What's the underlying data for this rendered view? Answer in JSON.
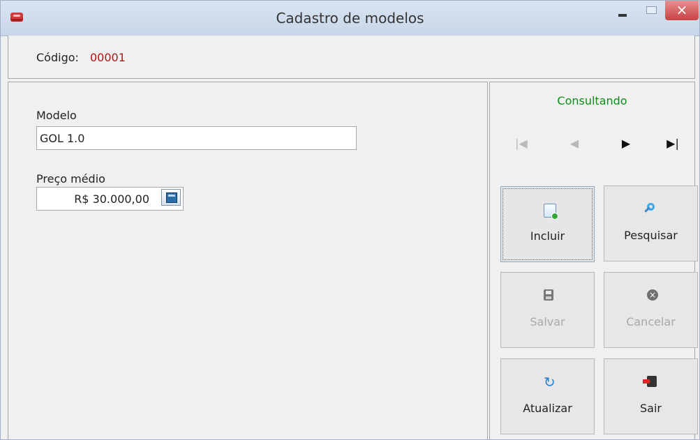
{
  "window": {
    "title": "Cadastro de modelos",
    "close": "×"
  },
  "code": {
    "label": "Código:",
    "value": "00001"
  },
  "form": {
    "model_label": "Modelo",
    "model_value": "GOL 1.0",
    "price_label": "Preço médio",
    "price_value": "R$ 30.000,00"
  },
  "status": "Consultando",
  "navigation": [
    {
      "label": "|◀",
      "enabled": false
    },
    {
      "label": "◀",
      "enabled": false
    },
    {
      "label": "▶",
      "enabled": true
    },
    {
      "label": "▶|",
      "enabled": true
    }
  ],
  "buttons": {
    "include": "Incluir",
    "search": "Pesquisar",
    "save": "Salvar",
    "cancel": "Cancelar",
    "update": "Atualizar",
    "exit": "Sair"
  },
  "icons": {
    "refresh": "↻"
  },
  "colors": {
    "status": "#0d8d16",
    "code_value": "#b31212"
  }
}
